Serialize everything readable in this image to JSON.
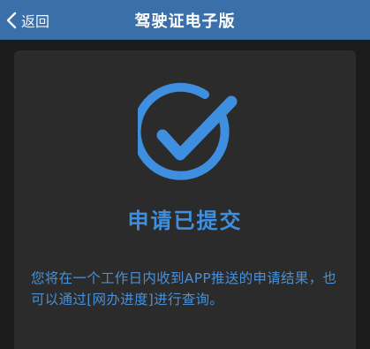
{
  "header": {
    "back_label": "返回",
    "title": "驾驶证电子版"
  },
  "result": {
    "icon": "check-circle-icon",
    "heading": "申请已提交",
    "message": "您将在一个工作日内收到APP推送的申请结果，也可以通过[网办进度]进行查询。"
  },
  "colors": {
    "header_bg": "#3a6faa",
    "accent": "#3f8fe0",
    "card_bg": "#2b2b2b",
    "page_bg": "#1b1b1b"
  }
}
